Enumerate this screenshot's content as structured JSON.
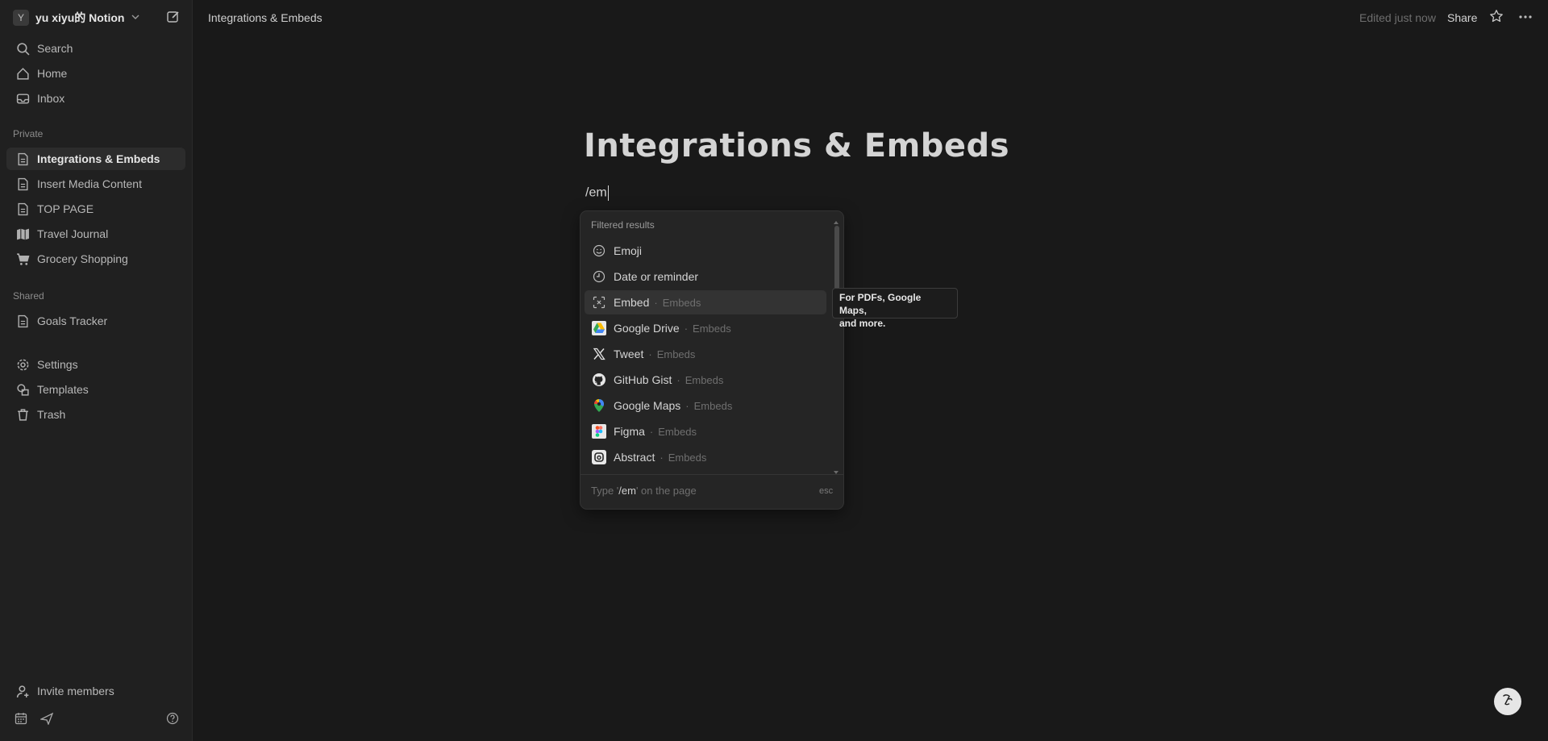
{
  "workspace": {
    "avatar_letter": "Y",
    "name": "yu xiyu的 Notion"
  },
  "sidebar": {
    "top_items": [
      {
        "label": "Search",
        "icon": "search-icon"
      },
      {
        "label": "Home",
        "icon": "home-icon"
      },
      {
        "label": "Inbox",
        "icon": "inbox-icon"
      }
    ],
    "private_label": "Private",
    "private_items": [
      {
        "label": "Integrations & Embeds",
        "icon": "page-icon",
        "active": true
      },
      {
        "label": "Insert Media Content",
        "icon": "page-icon"
      },
      {
        "label": "TOP PAGE",
        "icon": "page-icon"
      },
      {
        "label": "Travel Journal",
        "icon": "map-icon"
      },
      {
        "label": "Grocery Shopping",
        "icon": "cart-icon"
      }
    ],
    "shared_label": "Shared",
    "shared_items": [
      {
        "label": "Goals Tracker",
        "icon": "page-icon"
      }
    ],
    "utility_items": [
      {
        "label": "Settings",
        "icon": "gear-icon"
      },
      {
        "label": "Templates",
        "icon": "shapes-icon"
      },
      {
        "label": "Trash",
        "icon": "trash-icon"
      }
    ],
    "invite_label": "Invite members"
  },
  "topbar": {
    "title": "Integrations & Embeds",
    "edited": "Edited just now",
    "share_label": "Share"
  },
  "page": {
    "title": "Integrations & Embeds",
    "command_text": "/em"
  },
  "slash_menu": {
    "header": "Filtered results",
    "items": [
      {
        "label": "Emoji",
        "category": "",
        "icon": "smiley-icon"
      },
      {
        "label": "Date or reminder",
        "category": "",
        "icon": "clock-icon"
      },
      {
        "label": "Embed",
        "category": "Embeds",
        "icon": "embed-icon",
        "selected": true
      },
      {
        "label": "Google Drive",
        "category": "Embeds",
        "icon": "google-drive-icon"
      },
      {
        "label": "Tweet",
        "category": "Embeds",
        "icon": "x-logo-icon"
      },
      {
        "label": "GitHub Gist",
        "category": "Embeds",
        "icon": "github-icon"
      },
      {
        "label": "Google Maps",
        "category": "Embeds",
        "icon": "google-maps-icon"
      },
      {
        "label": "Figma",
        "category": "Embeds",
        "icon": "figma-icon"
      },
      {
        "label": "Abstract",
        "category": "Embeds",
        "icon": "abstract-icon"
      }
    ],
    "footer_prefix": "Type '",
    "footer_query": "/em",
    "footer_suffix": "' on the page",
    "esc_label": "esc"
  },
  "tooltip": {
    "line1": "For PDFs, Google Maps,",
    "line2": "and more."
  }
}
